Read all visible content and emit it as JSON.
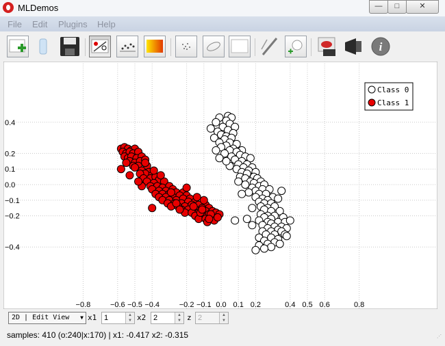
{
  "window": {
    "title": "MLDemos",
    "minimize_glyph": "—",
    "maximize_glyph": "□",
    "close_glyph": "✕"
  },
  "menu": [
    "File",
    "Edit",
    "Plugins",
    "Help"
  ],
  "toolbar_icons": [
    "new-data-icon",
    "clear-data-icon",
    "save-icon",
    "show-algorithms-icon",
    "plot-options-icon",
    "color-map-icon",
    "spray-icon",
    "ellipse-icon",
    "blank-canvas-icon",
    "draw-tools-icon",
    "add-point-icon",
    "screenshot-icon",
    "display-options-icon",
    "info-icon"
  ],
  "chart_data": {
    "type": "scatter",
    "xlim": [
      -0.9,
      0.9
    ],
    "ylim": [
      -0.48,
      0.48
    ],
    "x_ticks": [
      -0.8,
      -0.6,
      -0.5,
      -0.4,
      -0.2,
      -0.1,
      0.0,
      0.1,
      0.2,
      0.4,
      0.5,
      0.6,
      0.8
    ],
    "x_tick_labels": [
      "−0.8",
      "−0.6",
      "−0.5",
      "−0.4",
      "−0.2",
      "−0.1",
      "0.0",
      "0.1",
      "0.2",
      "0.4",
      "0.5",
      "0.6",
      "0.8"
    ],
    "y_ticks": [
      0.4,
      0.2,
      0.1,
      0.0,
      -0.1,
      -0.2,
      -0.4
    ],
    "y_tick_labels": [
      "0.4",
      "0.2",
      "0.1",
      "0.0",
      "−0.1",
      "−0.2",
      "−0.4"
    ],
    "grid": true,
    "legend_position": "top-right",
    "series": [
      {
        "name": "Class 0",
        "color": "#ffffff",
        "count": 240,
        "points": [
          [
            0.04,
            0.44
          ],
          [
            0.06,
            0.43
          ],
          [
            -0.01,
            0.43
          ],
          [
            0.03,
            0.41
          ],
          [
            0.05,
            0.39
          ],
          [
            -0.03,
            0.4
          ],
          [
            0.08,
            0.37
          ],
          [
            0.01,
            0.37
          ],
          [
            -0.06,
            0.36
          ],
          [
            0.04,
            0.35
          ],
          [
            0.07,
            0.33
          ],
          [
            -0.02,
            0.34
          ],
          [
            0.0,
            0.32
          ],
          [
            0.03,
            0.31
          ],
          [
            -0.04,
            0.3
          ],
          [
            0.06,
            0.3
          ],
          [
            0.02,
            0.29
          ],
          [
            -0.01,
            0.27
          ],
          [
            0.05,
            0.27
          ],
          [
            0.09,
            0.26
          ],
          [
            0.03,
            0.25
          ],
          [
            0.0,
            0.24
          ],
          [
            0.07,
            0.23
          ],
          [
            0.12,
            0.22
          ],
          [
            0.05,
            0.22
          ],
          [
            -0.03,
            0.22
          ],
          [
            0.09,
            0.21
          ],
          [
            0.02,
            0.2
          ],
          [
            0.11,
            0.19
          ],
          [
            0.06,
            0.18
          ],
          [
            0.14,
            0.18
          ],
          [
            -0.01,
            0.17
          ],
          [
            0.08,
            0.16
          ],
          [
            0.12,
            0.15
          ],
          [
            0.17,
            0.17
          ],
          [
            0.15,
            0.13
          ],
          [
            0.1,
            0.13
          ],
          [
            0.05,
            0.12
          ],
          [
            0.13,
            0.11
          ],
          [
            0.18,
            0.11
          ],
          [
            0.09,
            0.1
          ],
          [
            0.16,
            0.09
          ],
          [
            0.12,
            0.08
          ],
          [
            0.2,
            0.08
          ],
          [
            0.15,
            0.07
          ],
          [
            0.19,
            0.05
          ],
          [
            0.11,
            0.05
          ],
          [
            0.14,
            0.04
          ],
          [
            0.21,
            0.04
          ],
          [
            0.17,
            0.02
          ],
          [
            0.23,
            0.02
          ],
          [
            0.19,
            0.01
          ],
          [
            0.14,
            0.0
          ],
          [
            0.22,
            -0.01
          ],
          [
            0.25,
            0.0
          ],
          [
            0.18,
            -0.02
          ],
          [
            0.2,
            -0.04
          ],
          [
            0.24,
            -0.03
          ],
          [
            0.28,
            -0.03
          ],
          [
            0.16,
            -0.05
          ],
          [
            0.22,
            -0.06
          ],
          [
            0.26,
            -0.06
          ],
          [
            0.2,
            -0.08
          ],
          [
            0.24,
            -0.09
          ],
          [
            0.3,
            -0.08
          ],
          [
            0.27,
            -0.1
          ],
          [
            0.22,
            -0.11
          ],
          [
            0.25,
            -0.12
          ],
          [
            0.29,
            -0.12
          ],
          [
            0.33,
            -0.09
          ],
          [
            0.23,
            -0.14
          ],
          [
            0.27,
            -0.15
          ],
          [
            0.31,
            -0.14
          ],
          [
            0.25,
            -0.16
          ],
          [
            0.29,
            -0.17
          ],
          [
            0.34,
            -0.17
          ],
          [
            0.23,
            -0.19
          ],
          [
            0.27,
            -0.2
          ],
          [
            0.31,
            -0.2
          ],
          [
            0.25,
            -0.21
          ],
          [
            0.29,
            -0.22
          ],
          [
            0.36,
            -0.21
          ],
          [
            0.22,
            -0.23
          ],
          [
            0.27,
            -0.24
          ],
          [
            0.33,
            -0.24
          ],
          [
            0.29,
            -0.25
          ],
          [
            0.37,
            -0.24
          ],
          [
            0.24,
            -0.26
          ],
          [
            0.31,
            -0.27
          ],
          [
            0.35,
            -0.27
          ],
          [
            0.27,
            -0.28
          ],
          [
            0.33,
            -0.29
          ],
          [
            0.38,
            -0.28
          ],
          [
            0.24,
            -0.3
          ],
          [
            0.29,
            -0.3
          ],
          [
            0.35,
            -0.3
          ],
          [
            0.31,
            -0.32
          ],
          [
            0.26,
            -0.32
          ],
          [
            0.37,
            -0.32
          ],
          [
            0.22,
            -0.34
          ],
          [
            0.29,
            -0.34
          ],
          [
            0.33,
            -0.35
          ],
          [
            0.25,
            -0.36
          ],
          [
            0.31,
            -0.37
          ],
          [
            0.27,
            -0.38
          ],
          [
            0.34,
            -0.38
          ],
          [
            0.22,
            -0.39
          ],
          [
            0.29,
            -0.4
          ],
          [
            0.25,
            -0.41
          ],
          [
            0.2,
            -0.42
          ],
          [
            0.15,
            -0.22
          ],
          [
            0.18,
            -0.15
          ],
          [
            0.08,
            -0.23
          ],
          [
            0.12,
            -0.06
          ],
          [
            0.35,
            -0.04
          ],
          [
            0.4,
            -0.23
          ],
          [
            0.38,
            -0.33
          ],
          [
            0.03,
            0.15
          ],
          [
            0.1,
            0.02
          ],
          [
            0.18,
            -0.26
          ]
        ]
      },
      {
        "name": "Class 1",
        "color": "#e80000",
        "count": 170,
        "points": [
          [
            -0.58,
            0.23
          ],
          [
            -0.56,
            0.24
          ],
          [
            -0.54,
            0.23
          ],
          [
            -0.52,
            0.22
          ],
          [
            -0.5,
            0.23
          ],
          [
            -0.57,
            0.21
          ],
          [
            -0.55,
            0.2
          ],
          [
            -0.53,
            0.21
          ],
          [
            -0.51,
            0.2
          ],
          [
            -0.48,
            0.21
          ],
          [
            -0.56,
            0.18
          ],
          [
            -0.54,
            0.17
          ],
          [
            -0.52,
            0.18
          ],
          [
            -0.49,
            0.17
          ],
          [
            -0.46,
            0.18
          ],
          [
            -0.53,
            0.15
          ],
          [
            -0.5,
            0.14
          ],
          [
            -0.47,
            0.15
          ],
          [
            -0.44,
            0.16
          ],
          [
            -0.55,
            0.14
          ],
          [
            -0.51,
            0.12
          ],
          [
            -0.48,
            0.12
          ],
          [
            -0.43,
            0.12
          ],
          [
            -0.58,
            0.1
          ],
          [
            -0.46,
            0.09
          ],
          [
            -0.42,
            0.08
          ],
          [
            -0.44,
            0.07
          ],
          [
            -0.47,
            0.07
          ],
          [
            -0.4,
            0.06
          ],
          [
            -0.53,
            0.06
          ],
          [
            -0.45,
            0.04
          ],
          [
            -0.41,
            0.04
          ],
          [
            -0.38,
            0.05
          ],
          [
            -0.36,
            0.03
          ],
          [
            -0.43,
            0.02
          ],
          [
            -0.39,
            0.01
          ],
          [
            -0.33,
            0.02
          ],
          [
            -0.41,
            -0.01
          ],
          [
            -0.37,
            -0.01
          ],
          [
            -0.34,
            -0.02
          ],
          [
            -0.3,
            -0.01
          ],
          [
            -0.46,
            -0.01
          ],
          [
            -0.4,
            -0.03
          ],
          [
            -0.36,
            -0.04
          ],
          [
            -0.32,
            -0.04
          ],
          [
            -0.28,
            -0.03
          ],
          [
            -0.38,
            -0.06
          ],
          [
            -0.34,
            -0.06
          ],
          [
            -0.3,
            -0.06
          ],
          [
            -0.26,
            -0.05
          ],
          [
            -0.22,
            -0.05
          ],
          [
            -0.36,
            -0.08
          ],
          [
            -0.32,
            -0.08
          ],
          [
            -0.28,
            -0.08
          ],
          [
            -0.24,
            -0.07
          ],
          [
            -0.2,
            -0.07
          ],
          [
            -0.34,
            -0.1
          ],
          [
            -0.3,
            -0.1
          ],
          [
            -0.26,
            -0.1
          ],
          [
            -0.22,
            -0.09
          ],
          [
            -0.18,
            -0.09
          ],
          [
            -0.31,
            -0.12
          ],
          [
            -0.27,
            -0.12
          ],
          [
            -0.23,
            -0.12
          ],
          [
            -0.19,
            -0.11
          ],
          [
            -0.15,
            -0.11
          ],
          [
            -0.29,
            -0.14
          ],
          [
            -0.25,
            -0.14
          ],
          [
            -0.21,
            -0.14
          ],
          [
            -0.17,
            -0.13
          ],
          [
            -0.13,
            -0.13
          ],
          [
            -0.09,
            -0.13
          ],
          [
            -0.23,
            -0.16
          ],
          [
            -0.19,
            -0.16
          ],
          [
            -0.15,
            -0.16
          ],
          [
            -0.11,
            -0.15
          ],
          [
            -0.07,
            -0.15
          ],
          [
            -0.21,
            -0.18
          ],
          [
            -0.17,
            -0.18
          ],
          [
            -0.13,
            -0.18
          ],
          [
            -0.09,
            -0.17
          ],
          [
            -0.05,
            -0.17
          ],
          [
            -0.15,
            -0.2
          ],
          [
            -0.11,
            -0.2
          ],
          [
            -0.07,
            -0.19
          ],
          [
            -0.03,
            -0.18
          ],
          [
            -0.13,
            -0.22
          ],
          [
            -0.09,
            -0.22
          ],
          [
            -0.05,
            -0.21
          ],
          [
            -0.01,
            -0.19
          ],
          [
            -0.08,
            -0.24
          ],
          [
            -0.04,
            -0.23
          ],
          [
            -0.06,
            -0.19
          ],
          [
            -0.1,
            -0.1
          ],
          [
            -0.14,
            -0.08
          ],
          [
            -0.26,
            -0.12
          ],
          [
            -0.4,
            -0.15
          ],
          [
            -0.48,
            0.02
          ],
          [
            -0.5,
            0.11
          ],
          [
            -0.44,
            0.14
          ],
          [
            -0.2,
            -0.02
          ],
          [
            -0.12,
            -0.18
          ],
          [
            -0.02,
            -0.21
          ],
          [
            -0.16,
            -0.14
          ],
          [
            -0.24,
            -0.16
          ],
          [
            -0.35,
            0.06
          ],
          [
            -0.39,
            0.09
          ],
          [
            -0.29,
            -0.05
          ],
          [
            -0.07,
            -0.22
          ],
          [
            -0.11,
            -0.16
          ]
        ]
      }
    ]
  },
  "controls": {
    "view_mode": "2D | Edit View",
    "x1_label": "x1",
    "x1_value": "1",
    "x2_label": "x2",
    "x2_value": "2",
    "z_label": "z",
    "z_value": "2"
  },
  "status": {
    "text": "samples: 410 (o:240|x:170) | x1: -0.417 x2: -0.315"
  }
}
